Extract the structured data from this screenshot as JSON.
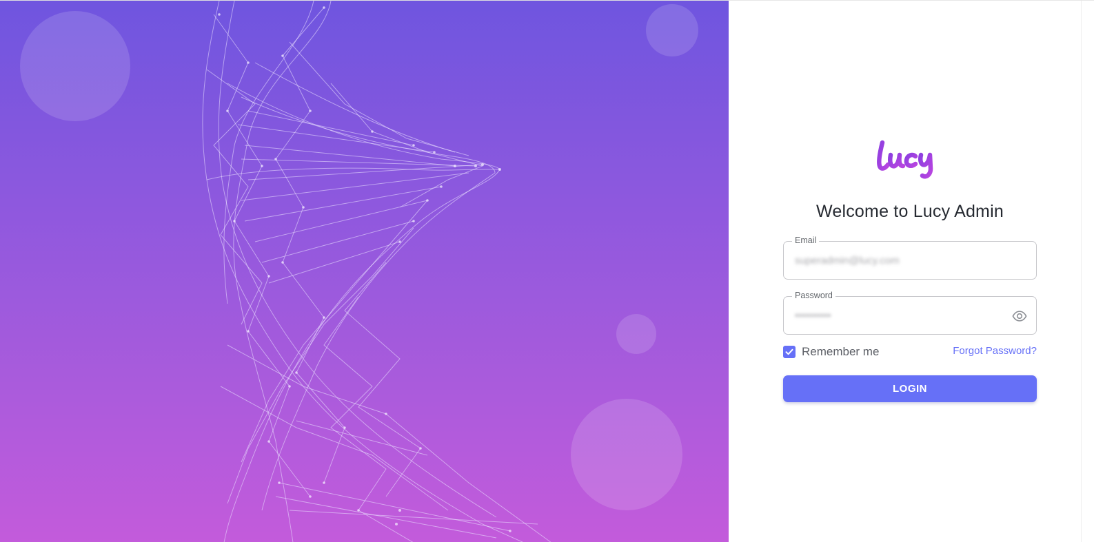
{
  "hero": {
    "background_top": "#6f55df",
    "background_bottom": "#c35bdb",
    "illustration": "dna-helix-illustration"
  },
  "logo": {
    "text": "Lucy",
    "color": "#9b3ee0"
  },
  "login": {
    "title": "Welcome to Lucy Admin",
    "email_label": "Email",
    "email_value": "superadmin@lucy.com",
    "password_label": "Password",
    "password_value": "••••••••••",
    "remember_label": "Remember me",
    "remember_checked": true,
    "forgot_label": "Forgot Password?",
    "login_label": "LOGIN",
    "accent": "#6670f7"
  },
  "icons": {
    "password_toggle": "eye-icon",
    "checkbox": "check-icon"
  }
}
